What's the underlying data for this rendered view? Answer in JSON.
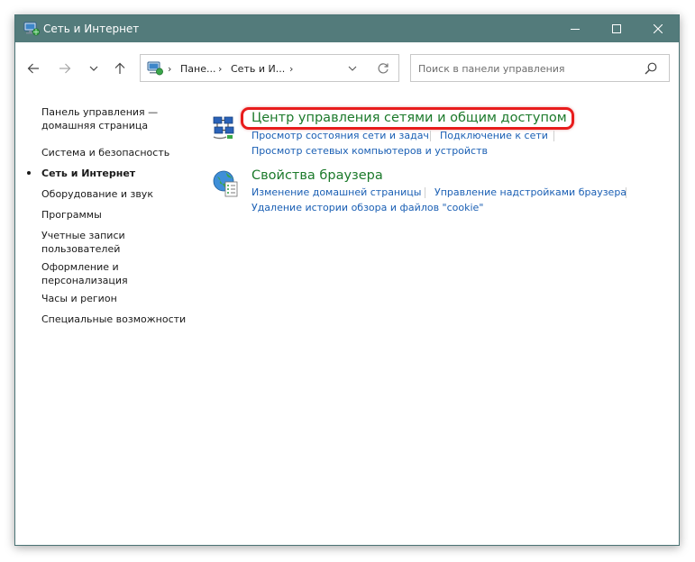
{
  "window": {
    "title": "Сеть и Интернет",
    "controls": {
      "minimize": "minimize-icon",
      "maximize": "maximize-icon",
      "close": "close-icon"
    }
  },
  "toolbar": {
    "address": {
      "segments": [
        "Пане...",
        "Сеть и И..."
      ]
    },
    "search": {
      "placeholder": "Поиск в панели управления",
      "value": ""
    }
  },
  "sidebar": {
    "items": [
      {
        "label": "Панель управления — домашняя страница",
        "active": false
      },
      {
        "label": "Система и безопасность",
        "active": false
      },
      {
        "label": "Сеть и Интернет",
        "active": true
      },
      {
        "label": "Оборудование и звук",
        "active": false
      },
      {
        "label": "Программы",
        "active": false
      },
      {
        "label": "Учетные записи пользователей",
        "active": false
      },
      {
        "label": "Оформление и персонализация",
        "active": false
      },
      {
        "label": "Часы и регион",
        "active": false
      },
      {
        "label": "Специальные возможности",
        "active": false
      }
    ]
  },
  "categories": [
    {
      "title": "Центр управления сетями и общим доступом",
      "icon": "network-center-icon",
      "links": [
        "Просмотр состояния сети и задач",
        "Подключение к сети",
        "Просмотр сетевых компьютеров и устройств"
      ]
    },
    {
      "title": "Свойства браузера",
      "icon": "internet-options-icon",
      "links": [
        "Изменение домашней страницы",
        "Управление надстройками браузера",
        "Удаление истории обзора и файлов \"cookie\""
      ]
    }
  ],
  "colors": {
    "titlebar": "#537b7b",
    "category_title": "#1c7a2b",
    "link": "#1a5fb4",
    "highlight": "#e81c1c"
  }
}
